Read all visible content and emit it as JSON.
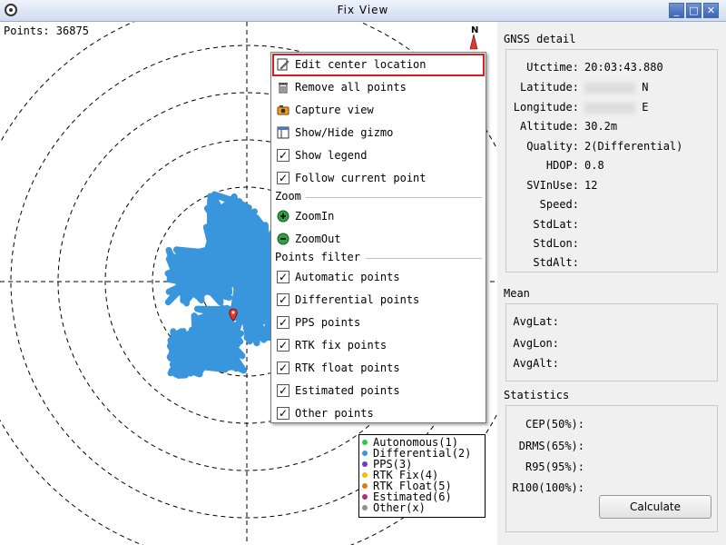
{
  "window": {
    "title": "Fix View"
  },
  "map": {
    "points_count_label": "Points: 36875",
    "north_label": "N",
    "point_color": "#3a96dc",
    "marker_color": "#e03a2f"
  },
  "menu": {
    "items": [
      {
        "label": "Edit center location",
        "icon": "edit-icon"
      },
      {
        "label": "Remove all points",
        "icon": "trash-icon"
      },
      {
        "label": "Capture view",
        "icon": "camera-icon"
      },
      {
        "label": "Show/Hide gizmo",
        "icon": "window-icon"
      },
      {
        "label": "Show legend",
        "checked": true
      },
      {
        "label": "Follow current point",
        "checked": true
      }
    ],
    "zoom_section": "Zoom",
    "zoom_items": [
      {
        "label": "ZoomIn",
        "icon": "zoom-in-icon"
      },
      {
        "label": "ZoomOut",
        "icon": "zoom-out-icon"
      }
    ],
    "filter_section": "Points filter",
    "filter_items": [
      {
        "label": "Automatic points",
        "checked": true
      },
      {
        "label": "Differential points",
        "checked": true
      },
      {
        "label": "PPS points",
        "checked": true
      },
      {
        "label": "RTK fix points",
        "checked": true
      },
      {
        "label": "RTK float points",
        "checked": true
      },
      {
        "label": "Estimated points",
        "checked": true
      },
      {
        "label": "Other points",
        "checked": true
      }
    ]
  },
  "legend": {
    "items": [
      {
        "label": "Autonomous(1)",
        "color": "#2ecc40"
      },
      {
        "label": "Differential(2)",
        "color": "#3a96dc"
      },
      {
        "label": "PPS(3)",
        "color": "#6a3dc8"
      },
      {
        "label": "RTK Fix(4)",
        "color": "#f0c000"
      },
      {
        "label": "RTK Float(5)",
        "color": "#e07a10"
      },
      {
        "label": "Estimated(6)",
        "color": "#b02a8a"
      },
      {
        "label": "Other(x)",
        "color": "#909090"
      }
    ]
  },
  "gnss": {
    "title": "GNSS detail",
    "utctime": {
      "label": "Utctime:",
      "value": "20:03:43.880"
    },
    "latitude": {
      "label": "Latitude:",
      "value": "N"
    },
    "longitude": {
      "label": "Longitude:",
      "value": "E"
    },
    "altitude": {
      "label": "Altitude:",
      "value": "30.2m"
    },
    "quality": {
      "label": "Quality:",
      "value": "2(Differential)"
    },
    "hdop": {
      "label": "HDOP:",
      "value": "0.8"
    },
    "svinuse": {
      "label": "SVInUse:",
      "value": "12"
    },
    "speed": {
      "label": "Speed:"
    },
    "stdlat": {
      "label": "StdLat:"
    },
    "stdlon": {
      "label": "StdLon:"
    },
    "stdalt": {
      "label": "StdAlt:"
    }
  },
  "mean": {
    "title": "Mean",
    "avglat": "AvgLat:",
    "avglon": "AvgLon:",
    "avgalt": "AvgAlt:"
  },
  "statistics": {
    "title": "Statistics",
    "cep": "CEP(50%):",
    "drms": "DRMS(65%):",
    "r95": "R95(95%):",
    "r100": "R100(100%):",
    "calculate_label": "Calculate"
  }
}
